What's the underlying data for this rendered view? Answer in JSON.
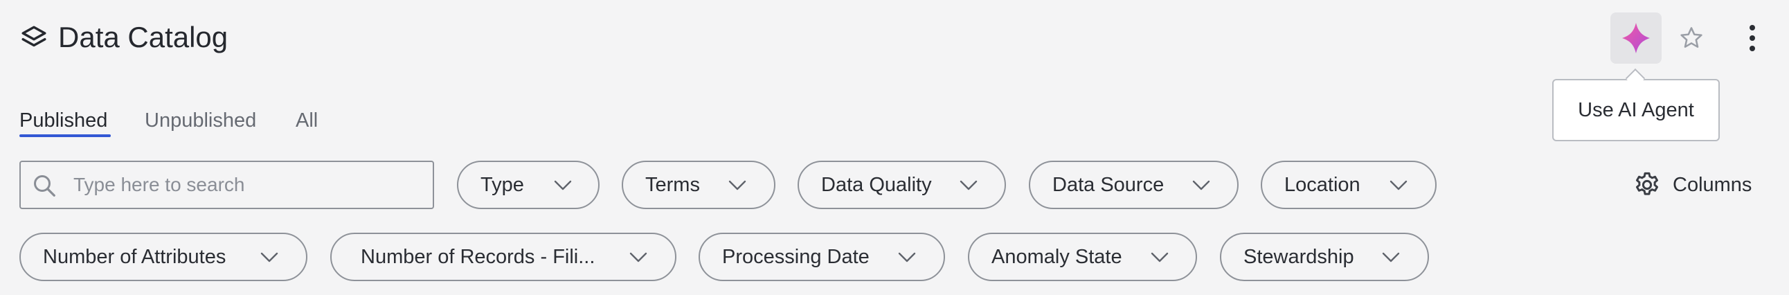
{
  "header": {
    "title": "Data Catalog",
    "icon": "layers-icon",
    "actions": {
      "ai_agent_icon": "sparkle-diamond-icon",
      "favorite_icon": "star-icon",
      "more_icon": "more-vertical-icon"
    },
    "tooltip": "Use AI Agent"
  },
  "tabs": [
    {
      "label": "Published",
      "active": true
    },
    {
      "label": "Unpublished",
      "active": false
    },
    {
      "label": "All",
      "active": false
    }
  ],
  "search": {
    "placeholder": "Type here to search",
    "value": ""
  },
  "filters": {
    "row1": [
      "Type",
      "Terms",
      "Data Quality",
      "Data Source",
      "Location"
    ],
    "row2": [
      "Number of Attributes",
      "Number of Records - Fili...",
      "Processing Date",
      "Anomaly State",
      "Stewardship"
    ]
  },
  "columns_button": {
    "label": "Columns",
    "icon": "gear-icon"
  },
  "colors": {
    "background": "#f4f4f5",
    "accent": "#3358d4",
    "ai_gradient_start": "#e3399a",
    "ai_gradient_end": "#b04bd6",
    "chip_border": "#8e9299"
  }
}
